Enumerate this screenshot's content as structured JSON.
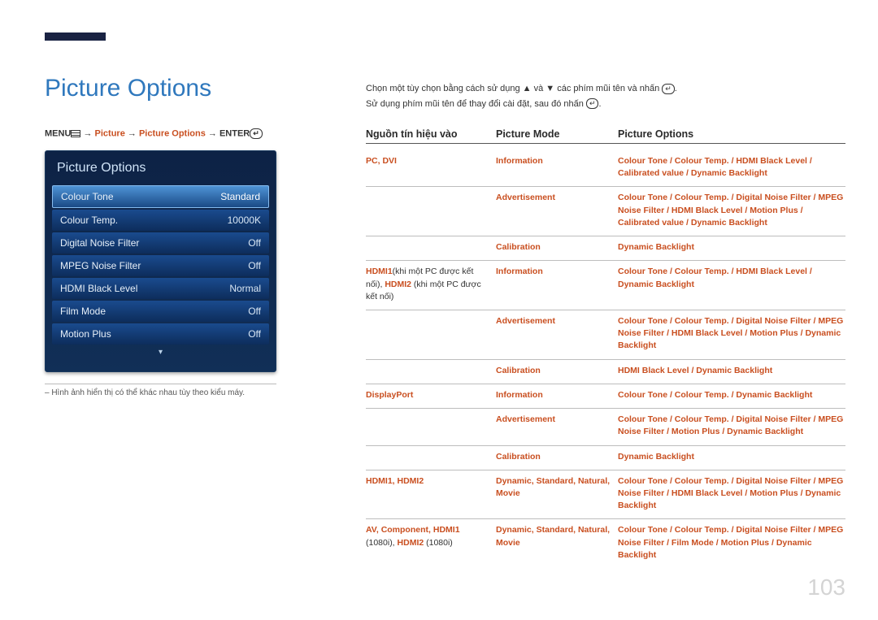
{
  "page": {
    "title": "Picture Options",
    "number": "103"
  },
  "breadcrumb": {
    "menu": "MENU",
    "arrow": " → ",
    "p1": "Picture",
    "p2": "Picture Options",
    "enter": "ENTER"
  },
  "osd": {
    "title": "Picture Options",
    "rows": [
      {
        "label": "Colour Tone",
        "value": "Standard",
        "selected": true
      },
      {
        "label": "Colour Temp.",
        "value": "10000K",
        "selected": false
      },
      {
        "label": "Digital Noise Filter",
        "value": "Off",
        "selected": false
      },
      {
        "label": "MPEG Noise Filter",
        "value": "Off",
        "selected": false
      },
      {
        "label": "HDMI Black Level",
        "value": "Normal",
        "selected": false
      },
      {
        "label": "Film Mode",
        "value": "Off",
        "selected": false
      },
      {
        "label": "Motion Plus",
        "value": "Off",
        "selected": false
      }
    ]
  },
  "footnote": "– Hình ảnh hiển thị có thể khác nhau tùy theo kiểu máy.",
  "intro": {
    "l1a": "Chọn một tùy chọn bằng cách sử dụng ",
    "l1b": " và ",
    "l1c": " các phím mũi tên và nhấn ",
    "l1d": ".",
    "l2a": "Sử dụng phím mũi tên để thay đổi cài đặt, sau đó nhấn ",
    "l2b": "."
  },
  "table": {
    "headers": {
      "h1": "Nguồn tín hiệu vào",
      "h2": "Picture Mode",
      "h3": "Picture Options"
    }
  },
  "cells": {
    "c1src": "PC",
    "c1sep": ", ",
    "c1src2": "DVI",
    "r1m": "Information",
    "r1o": "Colour Tone / Colour Temp. / HDMI Black Level / Calibrated value / Dynamic Backlight",
    "r2m": "Advertisement",
    "r2o_a": "Colour Tone / Colour Temp. / Digital Noise Filter / MPEG Noise Filter / HDMI Black Level / Motion Plus / Calibrated value / Dynamic Backlight",
    "r3m": "Calibration",
    "r3o": "Dynamic Backlight",
    "c4src_a": "HDMI1",
    "c4src_txt1": "(khi một PC được kết nối), ",
    "c4src_b": "HDMI2",
    "c4src_txt2": " (khi một PC được kết nối)",
    "r4m": "Information",
    "r4o": "Colour Tone / Colour Temp. / HDMI Black Level / Dynamic Backlight",
    "r5m": "Advertisement",
    "r5o": "Colour Tone / Colour Temp. / Digital Noise Filter / MPEG Noise Filter / HDMI Black Level / Motion Plus / Dynamic Backlight",
    "r6m": "Calibration",
    "r6o": "HDMI Black Level / Dynamic Backlight",
    "c7src": "DisplayPort",
    "r7m": "Information",
    "r7o": "Colour Tone / Colour Temp. / Dynamic Backlight",
    "r8m": "Advertisement",
    "r8o": "Colour Tone / Colour Temp. / Digital Noise Filter / MPEG Noise Filter / Motion Plus / Dynamic Backlight",
    "r9m": "Calibration",
    "r9o": "Dynamic Backlight",
    "c10src_a": "HDMI1",
    "c10sep": ", ",
    "c10src_b": "HDMI2",
    "r10m": "Dynamic, Standard, Natural, Movie",
    "r10o": "Colour Tone / Colour Temp. / Digital Noise Filter / MPEG Noise Filter / HDMI Black Level / Motion Plus / Dynamic Backlight",
    "c11src_a": "AV",
    "c11src_b": "Component",
    "c11src_c": "HDMI1",
    "c11txt1": " (1080i), ",
    "c11src_d": "HDMI2",
    "c11txt2": " (1080i)",
    "r11m": "Dynamic, Standard, Natural, Movie",
    "r11o": "Colour Tone / Colour Temp. / Digital Noise Filter / MPEG Noise Filter / Film Mode / Motion Plus / Dynamic Backlight"
  }
}
